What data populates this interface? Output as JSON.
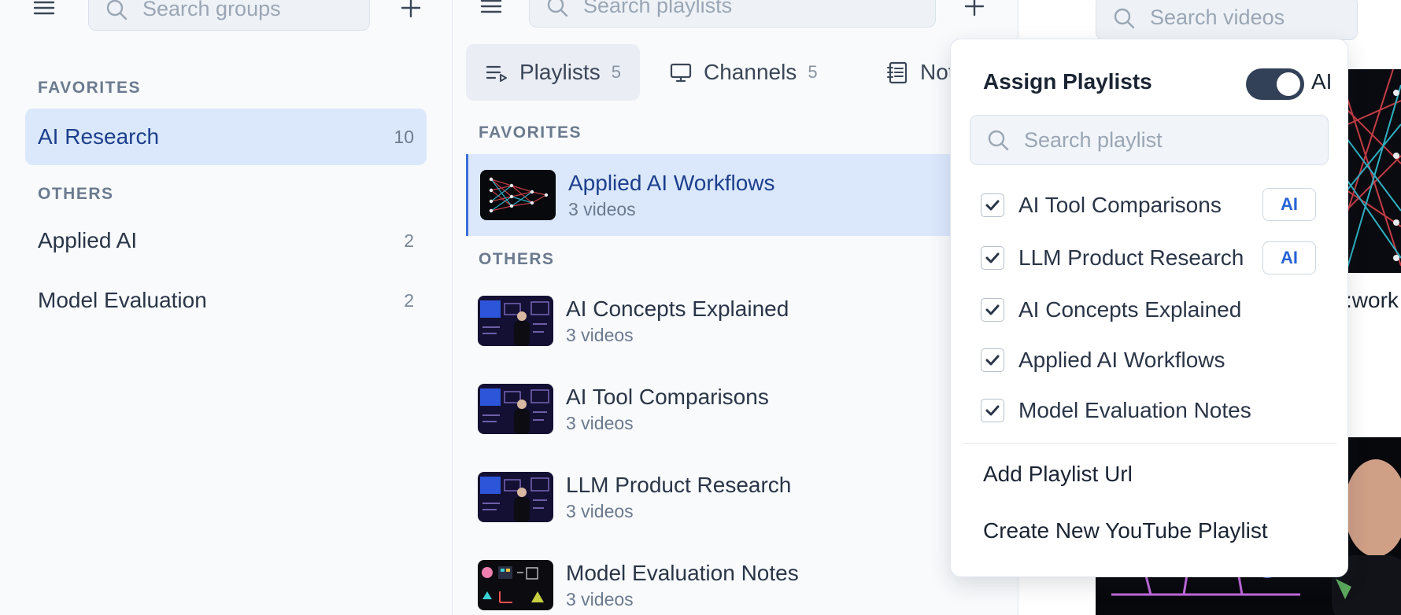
{
  "groups_panel": {
    "search_placeholder": "Search groups",
    "favorites_label": "FAVORITES",
    "others_label": "OTHERS",
    "favorites": [
      {
        "name": "AI Research",
        "count": "10"
      }
    ],
    "others": [
      {
        "name": "Applied AI",
        "count": "2"
      },
      {
        "name": "Model Evaluation",
        "count": "2"
      }
    ]
  },
  "playlists_panel": {
    "search_placeholder": "Search playlists",
    "tabs": [
      {
        "label": "Playlists",
        "count": "5",
        "icon": "playlist-icon"
      },
      {
        "label": "Channels",
        "count": "5",
        "icon": "monitor-icon"
      },
      {
        "label": "Note",
        "icon": "notebook-icon"
      }
    ],
    "favorites_label": "FAVORITES",
    "others_label": "OTHERS",
    "favorites": [
      {
        "title": "Applied AI Workflows",
        "subtitle": "3 videos"
      }
    ],
    "others": [
      {
        "title": "AI Concepts Explained",
        "subtitle": "3 videos"
      },
      {
        "title": "AI Tool Comparisons",
        "subtitle": "3 videos"
      },
      {
        "title": "LLM Product Research",
        "subtitle": "3 videos"
      },
      {
        "title": "Model Evaluation Notes",
        "subtitle": "3 videos"
      }
    ]
  },
  "videos_panel": {
    "search_placeholder": "Search videos",
    "partial_title": ":work"
  },
  "assign_popover": {
    "title": "Assign Playlists",
    "toggle_label": "AI",
    "toggle_on": true,
    "search_placeholder": "Search playlist",
    "items": [
      {
        "label": "AI Tool Comparisons",
        "checked": true,
        "badge": "AI"
      },
      {
        "label": "LLM Product Research",
        "checked": true,
        "badge": "AI"
      },
      {
        "label": "AI Concepts Explained",
        "checked": true
      },
      {
        "label": "Applied AI Workflows",
        "checked": true
      },
      {
        "label": "Model Evaluation Notes",
        "checked": true
      }
    ],
    "actions": [
      "Add Playlist Url",
      "Create New YouTube Playlist"
    ]
  },
  "colors": {
    "accent": "#3b6fd8",
    "selected_bg": "#dbe8fc",
    "ai_badge_text": "#2563d6",
    "toggle_on": "#324058"
  }
}
